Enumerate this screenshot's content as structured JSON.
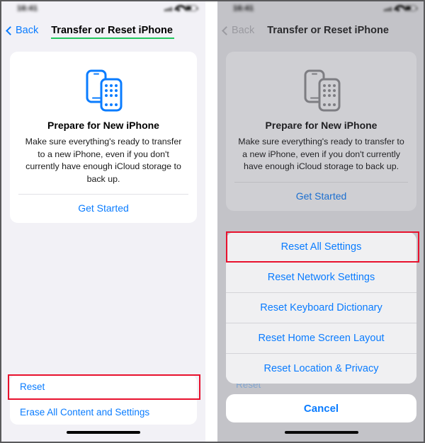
{
  "panels": {
    "left": {
      "statusbar": {
        "time": "16:41",
        "signal_icon": "cellular-signal-icon",
        "wifi_icon": "wifi-icon",
        "battery_icon": "battery-icon"
      },
      "nav": {
        "back_label": "Back",
        "title": "Transfer or Reset iPhone",
        "back_icon": "chevron-left-icon",
        "underline_color": "#22c55e"
      },
      "card": {
        "icon": "two-iphones-icon",
        "title": "Prepare for New iPhone",
        "description": "Make sure everything's ready to transfer to a new iPhone, even if you don't currently have enough iCloud storage to back up.",
        "action_label": "Get Started"
      },
      "reset_group": {
        "rows": [
          {
            "label": "Reset",
            "highlighted": true
          },
          {
            "label": "Erase All Content and Settings",
            "highlighted": false
          }
        ]
      },
      "home_indicator": "home-indicator"
    },
    "right": {
      "statusbar": {
        "time": "16:41",
        "signal_icon": "cellular-signal-icon",
        "wifi_icon": "wifi-icon",
        "battery_icon": "battery-icon"
      },
      "nav": {
        "back_label": "Back",
        "title": "Transfer or Reset iPhone",
        "back_icon": "chevron-left-icon"
      },
      "card": {
        "icon": "two-iphones-icon",
        "title": "Prepare for New iPhone",
        "description": "Make sure everything's ready to transfer to a new iPhone, even if you don't currently have enough iCloud storage to back up.",
        "action_label": "Get Started"
      },
      "background_row_label": "Reset",
      "action_sheet": {
        "options": [
          {
            "label": "Reset All Settings",
            "highlighted": true
          },
          {
            "label": "Reset Network Settings",
            "highlighted": false
          },
          {
            "label": "Reset Keyboard Dictionary",
            "highlighted": false
          },
          {
            "label": "Reset Home Screen Layout",
            "highlighted": false
          },
          {
            "label": "Reset Location & Privacy",
            "highlighted": false
          }
        ],
        "cancel_label": "Cancel"
      },
      "home_indicator": "home-indicator"
    }
  },
  "annotations": {
    "highlight_color": "#e8112d",
    "boxes": [
      {
        "target": "Reset",
        "panel": "left"
      },
      {
        "target": "Reset All Settings",
        "panel": "right"
      }
    ]
  },
  "colors": {
    "ios_blue": "#0a7cff",
    "left_background": "#f2f1f6",
    "right_background": "#c3c3c8",
    "card_white": "#ffffff",
    "green_underline": "#22c55e",
    "annotation_red": "#e8112d"
  }
}
